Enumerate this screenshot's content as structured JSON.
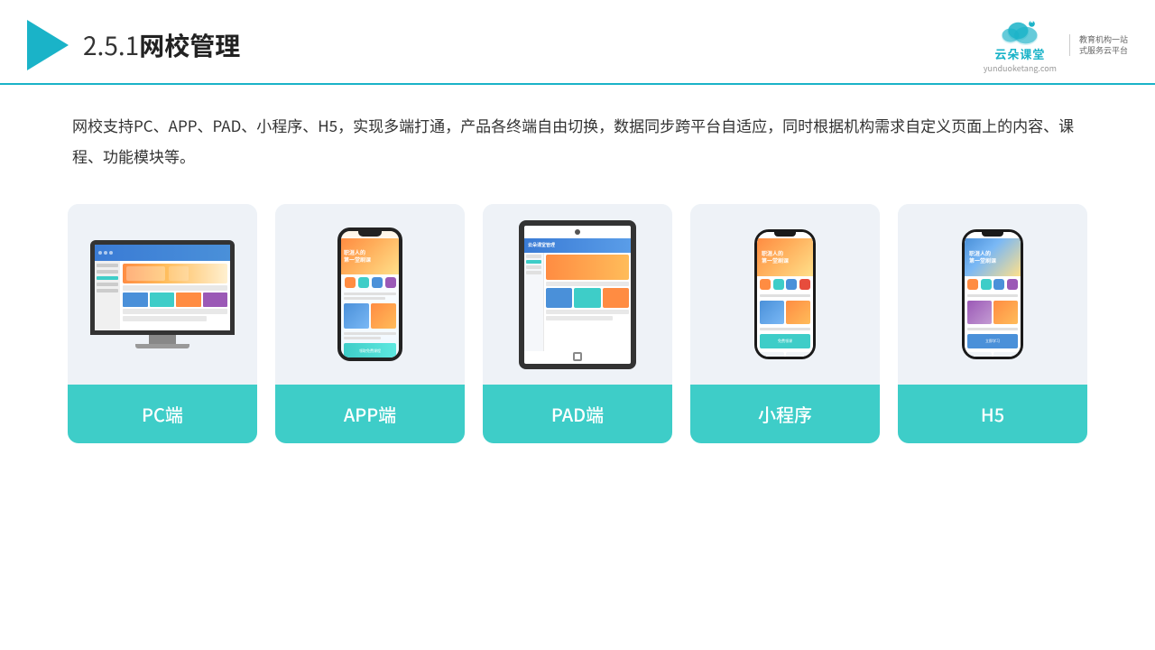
{
  "header": {
    "title": "2.5.1网校管理",
    "title_number": "2.5.1",
    "title_text": "网校管理",
    "brand": {
      "name": "云朵课堂",
      "url": "yunduoketang.com",
      "tagline": "教育机构一站\n式服务云平台"
    }
  },
  "description": {
    "text": "网校支持PC、APP、PAD、小程序、H5，实现多端打通，产品各终端自由切换，数据同步跨平台自适应，同时根据机构需求自定义页面上的内容、课程、功能模块等。"
  },
  "cards": [
    {
      "id": "pc",
      "label": "PC端"
    },
    {
      "id": "app",
      "label": "APP端"
    },
    {
      "id": "pad",
      "label": "PAD端"
    },
    {
      "id": "miniprogram",
      "label": "小程序"
    },
    {
      "id": "h5",
      "label": "H5"
    }
  ],
  "colors": {
    "accent": "#3ecdc8",
    "header_line": "#1ab3c8",
    "card_bg": "#eef2f7",
    "label_bg": "#3ecdc8",
    "orange": "#ff8c42",
    "blue": "#4a90d9"
  }
}
